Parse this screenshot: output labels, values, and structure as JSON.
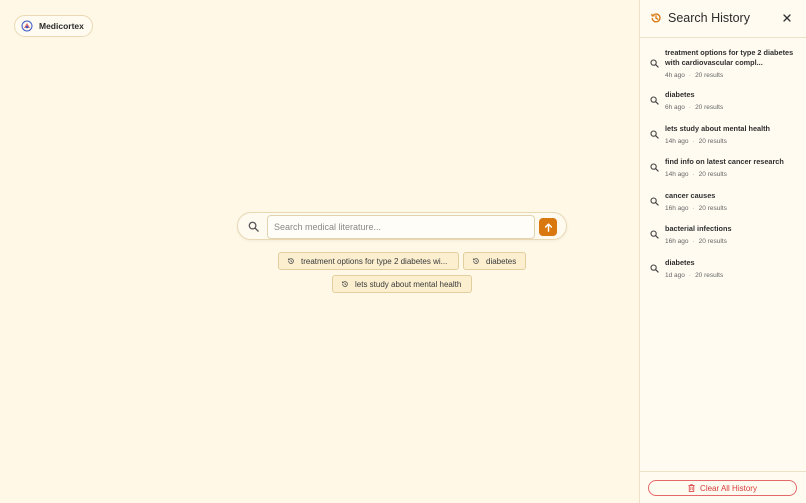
{
  "brand": {
    "name": "Medicortex"
  },
  "search": {
    "placeholder": "Search medical literature...",
    "value": ""
  },
  "suggestions": [
    {
      "label": "treatment options for type 2 diabetes wi..."
    },
    {
      "label": "diabetes"
    },
    {
      "label": "lets study about mental health"
    }
  ],
  "history_panel": {
    "title": "Search History",
    "items": [
      {
        "query": "treatment options for type 2 diabetes with cardiovascular compl...",
        "time": "4h ago",
        "results": "20 results"
      },
      {
        "query": "diabetes",
        "time": "6h ago",
        "results": "20 results"
      },
      {
        "query": "lets study about mental health",
        "time": "14h ago",
        "results": "20 results"
      },
      {
        "query": "find info on latest cancer research",
        "time": "14h ago",
        "results": "20 results"
      },
      {
        "query": "cancer causes",
        "time": "16h ago",
        "results": "20 results"
      },
      {
        "query": "bacterial infections",
        "time": "16h ago",
        "results": "20 results"
      },
      {
        "query": "diabetes",
        "time": "1d ago",
        "results": "20 results"
      }
    ],
    "separator": "·",
    "clear_label": "Clear All History"
  },
  "colors": {
    "background": "#fff8e6",
    "accent": "#d9780f",
    "danger": "#d83a3a",
    "chip": "#fbefcf"
  },
  "icons": [
    "medicortex-logo-icon",
    "search-icon",
    "arrow-up-icon",
    "history-icon",
    "close-icon",
    "trash-icon"
  ]
}
